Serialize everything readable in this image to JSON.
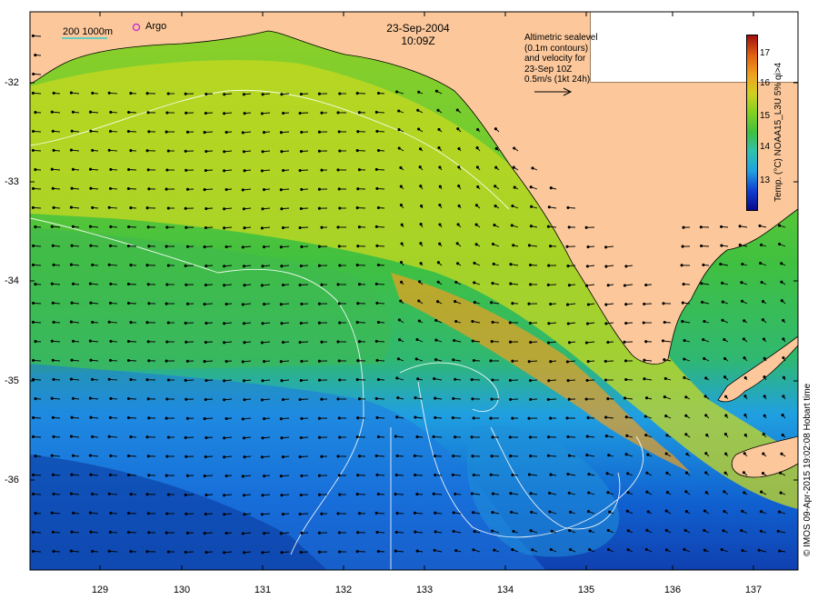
{
  "title": {
    "date": "23-Sep-2004",
    "time": "10:09Z"
  },
  "scale_legend": {
    "label": "200  1000m",
    "color": "#33cccc"
  },
  "argo_legend": {
    "label": "Argo",
    "color": "#cc33cc"
  },
  "annotation": {
    "lines": [
      "Altimetric sealevel",
      "(0.1m contours)",
      "and velocity for",
      "23-Sep 10Z",
      "0.5m/s (1kt 24h)"
    ]
  },
  "colorbar": {
    "label": "Temp. (°C) NOAA15_L3U 5% qi>4",
    "ticks": [
      "17",
      "16",
      "15",
      "14",
      "13"
    ],
    "colors": [
      "#08088a",
      "#1040d0",
      "#20a0e0",
      "#30c0b0",
      "#40c040",
      "#80d020",
      "#d0d020",
      "#f0a020",
      "#e06010",
      "#a01010"
    ]
  },
  "credit": "© IMOS 09-Apr-2015 19:02:08 Hobart time",
  "axes": {
    "y_ticks": [
      "-32",
      "-33",
      "-34",
      "-35",
      "-36"
    ],
    "x_ticks": [
      "129",
      "130",
      "131",
      "132",
      "133",
      "134",
      "135",
      "136",
      "137"
    ]
  },
  "colors": {
    "land": "#fcc89b",
    "frame": "#000000",
    "contour": "#ffffff"
  }
}
